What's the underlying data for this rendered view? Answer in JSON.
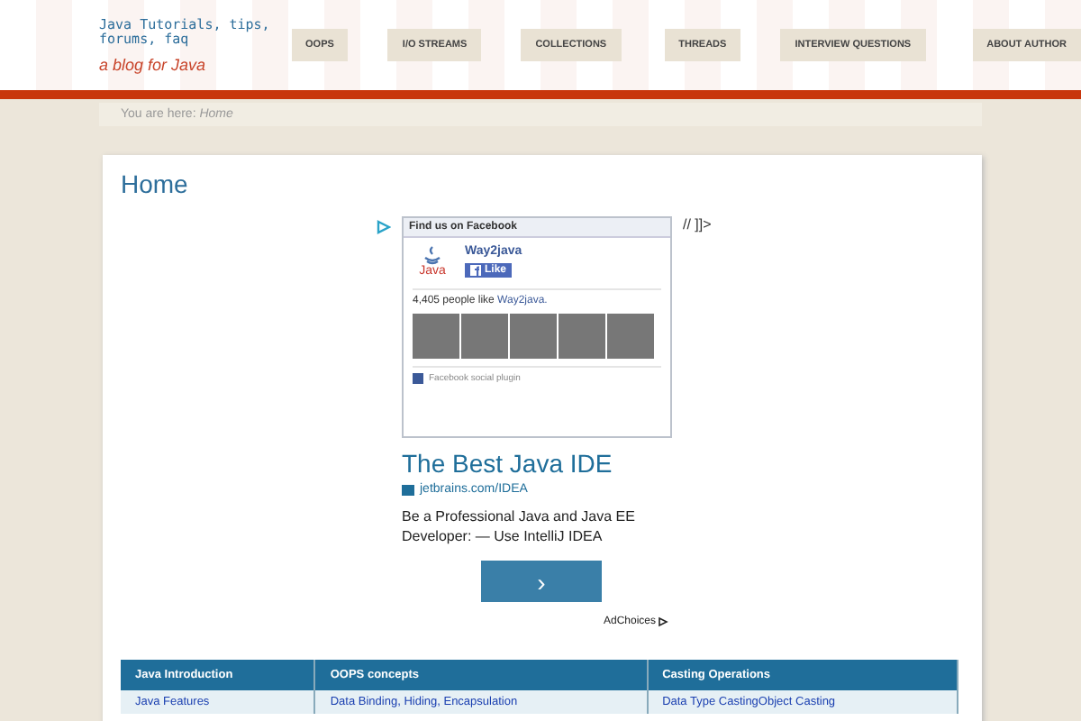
{
  "site": {
    "title": "Java Tutorials, tips, forums, faq",
    "tagline": "a blog for Java"
  },
  "nav": [
    {
      "label": "OOPS"
    },
    {
      "label": "I/O STREAMS"
    },
    {
      "label": "COLLECTIONS"
    },
    {
      "label": "THREADS"
    },
    {
      "label": "INTERVIEW QUESTIONS"
    },
    {
      "label": "ABOUT AUTHOR"
    }
  ],
  "breadcrumb": {
    "prefix": "You are here:",
    "current": "Home"
  },
  "page_title": "Home",
  "stray_text": "// ]]>",
  "facebook": {
    "header": "Find us on Facebook",
    "page_name": "Way2java",
    "logo_text": "Java",
    "like": "Like",
    "likes_prefix": "4,405 people like",
    "likes_link": "Way2java.",
    "footer": "Facebook social plugin"
  },
  "ad": {
    "headline": "The Best Java IDE",
    "url": "jetbrains.com/IDEA",
    "body": "Be a Professional Java and Java EE Developer: — Use IntelliJ IDEA",
    "button": "›",
    "adchoices": "AdChoices"
  },
  "table": {
    "columns": [
      "Java Introduction",
      "OOPS concepts",
      "Casting Operations"
    ],
    "rows": [
      [
        "Java Features",
        "Data Binding, Hiding, Encapsulation",
        "Data Type CastingObject Casting"
      ]
    ]
  }
}
